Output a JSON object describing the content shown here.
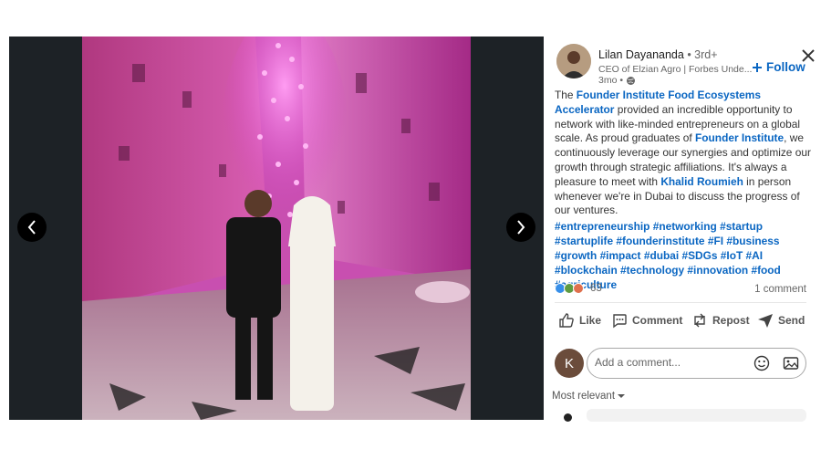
{
  "post": {
    "author": {
      "name": "Lilan Dayananda",
      "degree": "• 3rd+",
      "headline": "CEO of Elzian Agro | Forbes Unde...",
      "time": "3mo •",
      "follow_label": "Follow",
      "avatar": "person-avatar"
    },
    "body": {
      "p1": "The ",
      "link1": "Founder Institute Food Ecosystems Accelerator",
      "p2": " provided an incredible opportunity to network with like-minded entrepreneurs on a global scale. As proud graduates of ",
      "link2": "Founder Institute",
      "p3": ", we continuously leverage our synergies and optimize our growth through strategic affiliations. It's always a pleasure to meet with ",
      "link3": "Khalid Roumieh",
      "p4": " in person whenever we're in Dubai to discuss the progress of our ventures."
    },
    "hashtags": [
      "#entrepreneurship",
      "#networking",
      "#startup",
      "#startuplife",
      "#founderinstitute",
      "#FI",
      "#business",
      "#growth",
      "#impact",
      "#dubai",
      "#SDGs",
      "#IoT",
      "#AI",
      "#blockchain",
      "#technology",
      "#innovation",
      "#food",
      "#agriculture"
    ],
    "reactions_count": "63",
    "comments_count": "1 comment",
    "actions": {
      "like": "Like",
      "comment": "Comment",
      "repost": "Repost",
      "send": "Send"
    },
    "comment_box": {
      "avatar_initial": "K",
      "placeholder": "Add a comment..."
    },
    "sort_label": "Most relevant"
  },
  "colors": {
    "accent": "#0a66c2",
    "photo_magenta": "#d23fc0",
    "media_bg": "#1d2226"
  },
  "icons": [
    "chevron-left-icon",
    "chevron-right-icon",
    "close-icon",
    "globe-icon",
    "plus-icon",
    "like-icon",
    "comment-icon",
    "repost-icon",
    "send-icon",
    "emoji-icon",
    "image-icon",
    "caret-down-icon"
  ]
}
